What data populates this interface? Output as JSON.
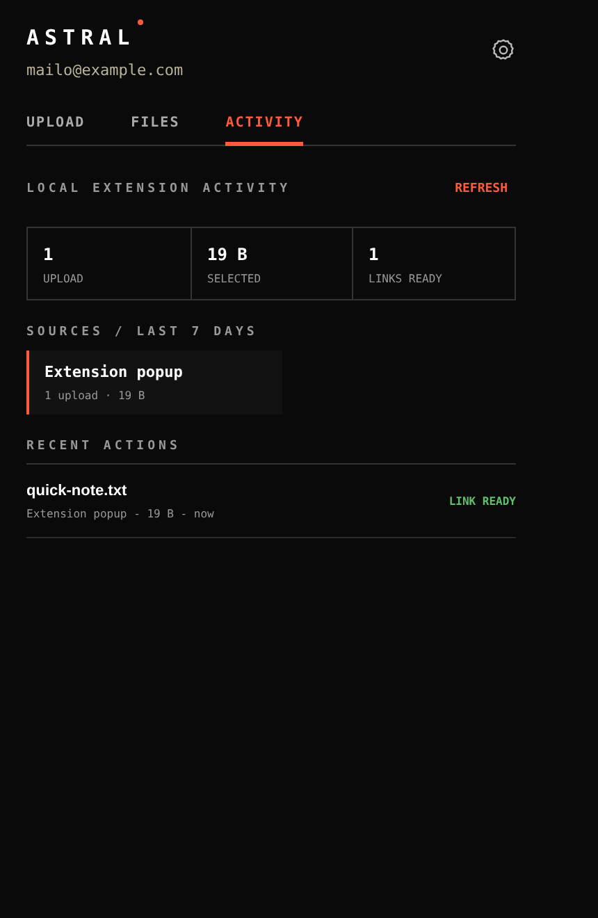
{
  "header": {
    "title": "ASTRAL",
    "notification_dot": true,
    "email": "mailo@example.com"
  },
  "tabs": [
    {
      "label": "UPLOAD",
      "selected": false
    },
    {
      "label": "FILES",
      "selected": false
    },
    {
      "label": "ACTIVITY",
      "selected": true
    }
  ],
  "activity": {
    "heading": "LOCAL EXTENSION ACTIVITY",
    "refresh": "REFRESH",
    "stats": [
      {
        "value": "1",
        "label": "UPLOAD"
      },
      {
        "value": "19 B",
        "label": "SELECTED"
      },
      {
        "value": "1",
        "label": "LINKS READY"
      }
    ],
    "sources_heading": "SOURCES / LAST 7 DAYS",
    "sources": [
      {
        "name": "Extension popup",
        "detail": "1 upload · 19 B"
      }
    ],
    "recent_heading": "RECENT ACTIONS",
    "actions": [
      {
        "name": "quick-note.txt",
        "detail": "Extension popup - 19 B - now",
        "status": "LINK READY",
        "kind": "ready"
      }
    ]
  }
}
